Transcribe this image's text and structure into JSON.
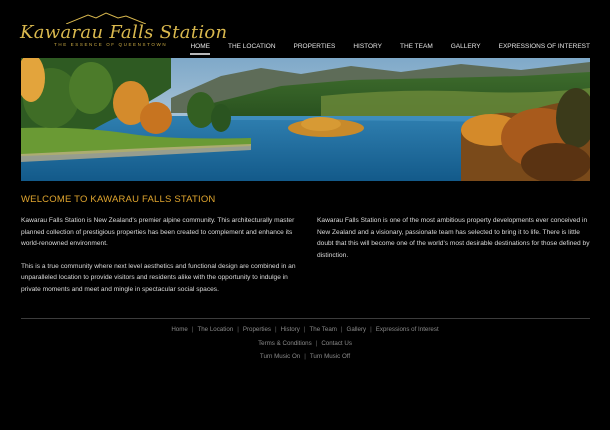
{
  "logo": {
    "brand": "Kawarau Falls Station",
    "tagline": "THE ESSENCE OF QUEENSTOWN"
  },
  "nav": {
    "items": [
      {
        "label": "HOME",
        "active": true
      },
      {
        "label": "THE LOCATION"
      },
      {
        "label": "PROPERTIES"
      },
      {
        "label": "HISTORY"
      },
      {
        "label": "THE TEAM"
      },
      {
        "label": "GALLERY"
      },
      {
        "label": "EXPRESSIONS OF INTEREST"
      }
    ]
  },
  "content": {
    "heading": "WELCOME TO KAWARAU FALLS STATION",
    "left": [
      "Kawarau Falls Station is New Zealand's premier alpine community. This architecturally master planned collection of prestigious properties has been created to complement and enhance its world-renowned environment.",
      "This is a true community where next level aesthetics and functional design are combined in an unparalleled location to provide visitors and residents alike with the opportunity to indulge in private moments and meet and mingle in spectacular social spaces."
    ],
    "right": [
      "Kawarau Falls Station is one of the most ambitious property developments ever conceived in New Zealand and a visionary, passionate team has selected to bring it to life. There is little doubt that this will become one of the world's most desirable destinations for those defined by distinction."
    ]
  },
  "footer": {
    "links": [
      "Home",
      "The Location",
      "Properties",
      "History",
      "The Team",
      "Gallery",
      "Expressions of Interest"
    ],
    "legal": [
      "Terms & Conditions",
      "Contact Us"
    ],
    "music": [
      "Turn Music On",
      "Turn Music Off"
    ]
  },
  "colors": {
    "accent_gold": "#e0a52e",
    "background": "#000000"
  }
}
